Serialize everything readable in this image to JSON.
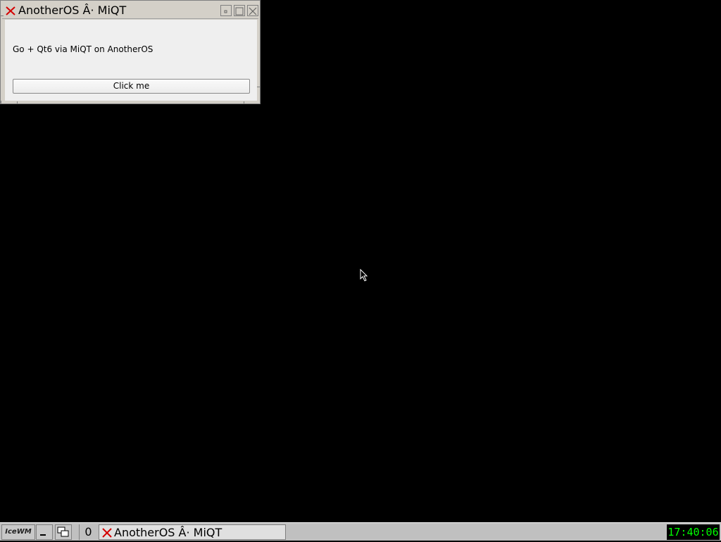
{
  "window": {
    "title": "AnotherOS Â· MiQT",
    "label_text": "Go + Qt6 via MiQT on AnotherOS",
    "button_label": "Click me"
  },
  "taskbar": {
    "start_label": "IceWM",
    "workspace": "0",
    "task_title": "AnotherOS Â· MiQT",
    "clock": "17:40:06"
  },
  "icons": {
    "app_icon": "red-x-icon",
    "minimize": "minimize-icon",
    "maximize": "maximize-icon",
    "close": "close-icon",
    "show_desktop": "minimize-all-icon",
    "window_list": "window-list-icon"
  },
  "colors": {
    "desktop": "#000000",
    "clock_fg": "#00ff00",
    "clock_bg": "#000000",
    "app_icon": "#d40000"
  }
}
